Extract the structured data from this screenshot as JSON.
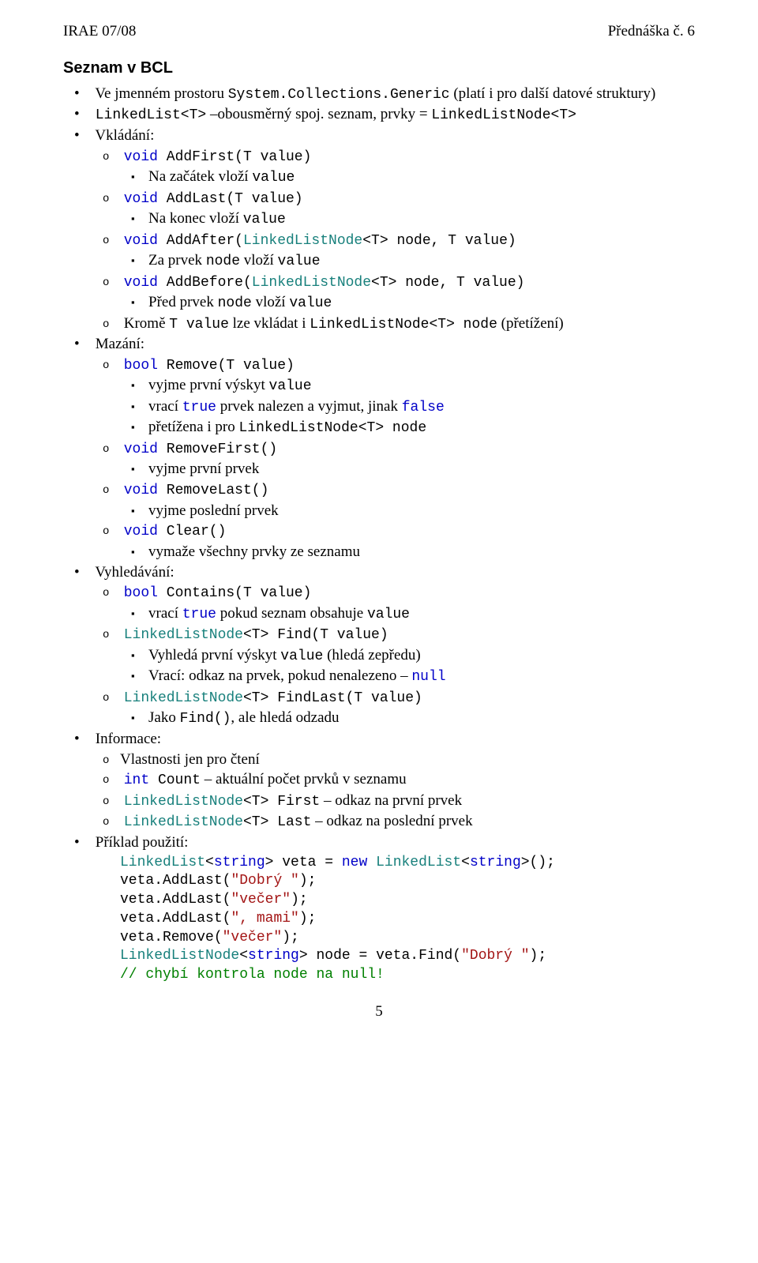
{
  "header": {
    "left": "IRAE 07/08",
    "right": "Přednáška č. 6"
  },
  "section_title": "Seznam v BCL",
  "l1": {
    "intro1": {
      "pre": "Ve jmenném prostoru ",
      "code": "System.Collections.Generic",
      "post": " (platí i pro další datové struktury)"
    },
    "intro2": {
      "code": "LinkedList<T>",
      "post": " –obousměrný spoj. seznam, prvky = ",
      "code2": "LinkedListNode<T>"
    },
    "vkladani": "Vkládání:",
    "mazani": "Mazání:",
    "vyhledavani": "Vyhledávání:",
    "informace": "Informace:",
    "priklad": "Příklad použití:"
  },
  "vkladani": {
    "i0": {
      "sig": {
        "ret": "void",
        "name": " AddFirst(T value)"
      },
      "desc": {
        "pre": "Na začátek vloží ",
        "code": "value"
      }
    },
    "i1": {
      "sig": {
        "ret": "void",
        "name": " AddLast(T value)"
      },
      "desc": {
        "pre": "Na konec vloží ",
        "code": "value"
      }
    },
    "i2": {
      "sig": {
        "ret": "void",
        "name": " AddAfter(",
        "type": "LinkedListNode",
        "tail": "<T> node, T value)"
      },
      "desc": {
        "pre": "Za prvek ",
        "code1": "node",
        "mid": " vloží ",
        "code2": "value"
      }
    },
    "i3": {
      "sig": {
        "ret": "void",
        "name": " AddBefore(",
        "type": "LinkedListNode",
        "tail": "<T> node, T value)"
      },
      "desc": {
        "pre": "Před prvek ",
        "code1": "node",
        "mid": " vloží ",
        "code2": "value"
      }
    },
    "i4": {
      "pre": "Kromě ",
      "code1": "T value",
      "mid": " lze vkládat i ",
      "code2": "LinkedListNode<T> node",
      "post": " (přetížení)"
    }
  },
  "mazani": {
    "i0": {
      "sig": {
        "ret": "bool",
        "name": " Remove(T value)"
      },
      "d0": {
        "pre": "vyjme první výskyt ",
        "code": "value"
      },
      "d1": {
        "pre": "vrací ",
        "kw1": "true",
        "mid": " prvek nalezen a vyjmut, jinak ",
        "kw2": "false"
      },
      "d2": {
        "pre": "přetížena i pro ",
        "code": "LinkedListNode<T> node"
      }
    },
    "i1": {
      "sig": {
        "ret": "void",
        "name": " RemoveFirst()"
      },
      "desc": "vyjme první prvek"
    },
    "i2": {
      "sig": {
        "ret": "void",
        "name": " RemoveLast()"
      },
      "desc": "vyjme poslední prvek"
    },
    "i3": {
      "sig": {
        "ret": "void",
        "name": " Clear()"
      },
      "desc": "vymaže všechny prvky ze seznamu"
    }
  },
  "vyhledavani": {
    "i0": {
      "sig": {
        "ret": "bool",
        "name": " Contains(T value)"
      },
      "desc": {
        "pre": "vrací ",
        "kw": "true",
        "mid": " pokud seznam obsahuje ",
        "code": "value"
      }
    },
    "i1": {
      "sig": {
        "type": "LinkedListNode",
        "tail": "<T> Find(T value)"
      },
      "d0": {
        "pre": "Vyhledá první výskyt ",
        "code": "value",
        "post": " (hledá zepředu)"
      },
      "d1": {
        "pre": "Vrací: odkaz na prvek, pokud nenalezeno – ",
        "kw": "null"
      }
    },
    "i2": {
      "sig": {
        "type": "LinkedListNode",
        "tail": "<T> FindLast(T value)"
      },
      "d0": {
        "pre": "Jako ",
        "code": "Find()",
        "post": ", ale hledá odzadu"
      }
    }
  },
  "informace": {
    "i0": "Vlastnosti jen pro čtení",
    "i1": {
      "ret": "int",
      "name": " Count",
      "post": " – aktuální počet prvků v seznamu"
    },
    "i2": {
      "type": "LinkedListNode",
      "tail": "<T> First",
      "post": " – odkaz na první prvek"
    },
    "i3": {
      "type": "LinkedListNode",
      "tail": "<T> Last",
      "post": " – odkaz na poslední prvek"
    }
  },
  "codeblock": {
    "l1": {
      "a": "LinkedList",
      "b": "<",
      "c": "string",
      "d": "> veta = ",
      "e": "new",
      "f": " ",
      "g": "LinkedList",
      "h": "<",
      "i": "string",
      "j": ">();"
    },
    "l2": {
      "a": "veta.AddLast(",
      "s": "\"Dobrý \"",
      "b": ");"
    },
    "l3": {
      "a": "veta.AddLast(",
      "s": "\"večer\"",
      "b": ");"
    },
    "l4": {
      "a": "veta.AddLast(",
      "s": "\", mami\"",
      "b": ");"
    },
    "l5": {
      "a": "veta.Remove(",
      "s": "\"večer\"",
      "b": ");"
    },
    "l6": {
      "a": "LinkedListNode",
      "b": "<",
      "c": "string",
      "d": "> node = veta.Find(",
      "s": "\"Dobrý \"",
      "e": ");"
    },
    "l7": "// chybí kontrola node na null!"
  },
  "page_num": "5"
}
